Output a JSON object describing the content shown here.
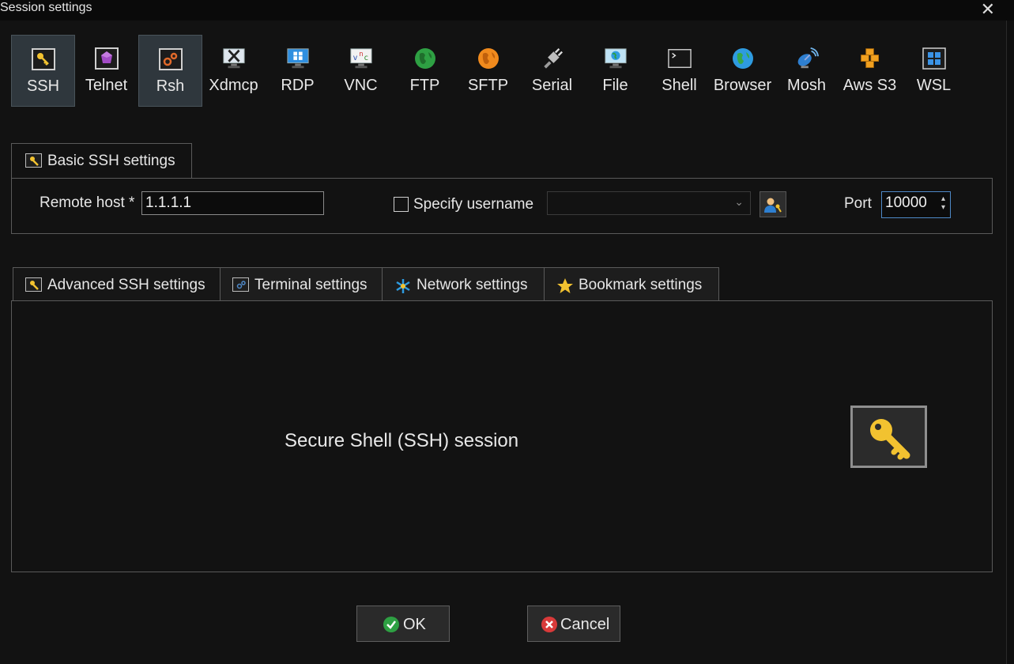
{
  "window": {
    "title": "Session settings",
    "close_glyph": "✕"
  },
  "session_types": [
    {
      "label": "SSH",
      "icon": "key-icon"
    },
    {
      "label": "Telnet",
      "icon": "telnet-gem-icon"
    },
    {
      "label": "Rsh",
      "icon": "gears-icon"
    },
    {
      "label": "Xdmcp",
      "icon": "x-monitor-icon"
    },
    {
      "label": "RDP",
      "icon": "windows-monitor-icon"
    },
    {
      "label": "VNC",
      "icon": "vnc-monitor-icon"
    },
    {
      "label": "FTP",
      "icon": "green-globe-icon"
    },
    {
      "label": "SFTP",
      "icon": "orange-globe-icon"
    },
    {
      "label": "Serial",
      "icon": "serial-plug-icon"
    },
    {
      "label": "File",
      "icon": "file-monitor-icon"
    },
    {
      "label": "Shell",
      "icon": "shell-terminal-icon"
    },
    {
      "label": "Browser",
      "icon": "browser-globe-icon"
    },
    {
      "label": "Mosh",
      "icon": "satellite-dish-icon"
    },
    {
      "label": "Aws S3",
      "icon": "aws-s3-cubes-icon"
    },
    {
      "label": "WSL",
      "icon": "wsl-windows-icon"
    }
  ],
  "basic": {
    "tab_label": "Basic SSH settings",
    "remote_host_label": "Remote host *",
    "remote_host_value": "1.1.1.1",
    "specify_username_label": "Specify username",
    "specify_username_checked": false,
    "username_value": "",
    "port_label": "Port",
    "port_value": "10000"
  },
  "advanced_tabs": [
    {
      "label": "Advanced SSH settings",
      "icon": "key-icon"
    },
    {
      "label": "Terminal settings",
      "icon": "terminal-gears-icon"
    },
    {
      "label": "Network settings",
      "icon": "network-star-icon"
    },
    {
      "label": "Bookmark settings",
      "icon": "star-icon"
    }
  ],
  "content": {
    "description": "Secure Shell (SSH) session",
    "icon": "big-key-icon"
  },
  "buttons": {
    "ok_label": "OK",
    "cancel_label": "Cancel"
  },
  "colors": {
    "background": "#121212",
    "selected_type_bg": "#2f373d",
    "border": "#5a5a5a",
    "port_focus": "#4e88c7",
    "ok_green": "#2ea043",
    "cancel_red": "#d93a3a",
    "key_gold": "#f2c230"
  }
}
